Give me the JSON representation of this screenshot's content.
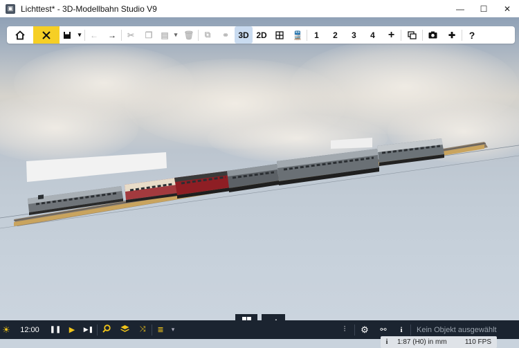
{
  "window": {
    "title": "Lichttest* - 3D-Modellbahn Studio V9",
    "minimize": "—",
    "maximize": "☐",
    "close": "✕"
  },
  "toolbar": {
    "view_3d": "3D",
    "view_2d": "2D",
    "layer_1": "1",
    "layer_2": "2",
    "layer_3": "3",
    "layer_4": "4",
    "add_layer": "+",
    "help": "?"
  },
  "bottombar": {
    "time": "12:00",
    "no_object_selected": "Kein Objekt ausgewählt"
  },
  "statusbar": {
    "scale": "1:87 (H0) in mm",
    "fps": "110 FPS"
  },
  "colors": {
    "accent_yellow": "#f6cf25",
    "active_blue": "#c9dbf0",
    "dark_bar": "#1b2430"
  }
}
